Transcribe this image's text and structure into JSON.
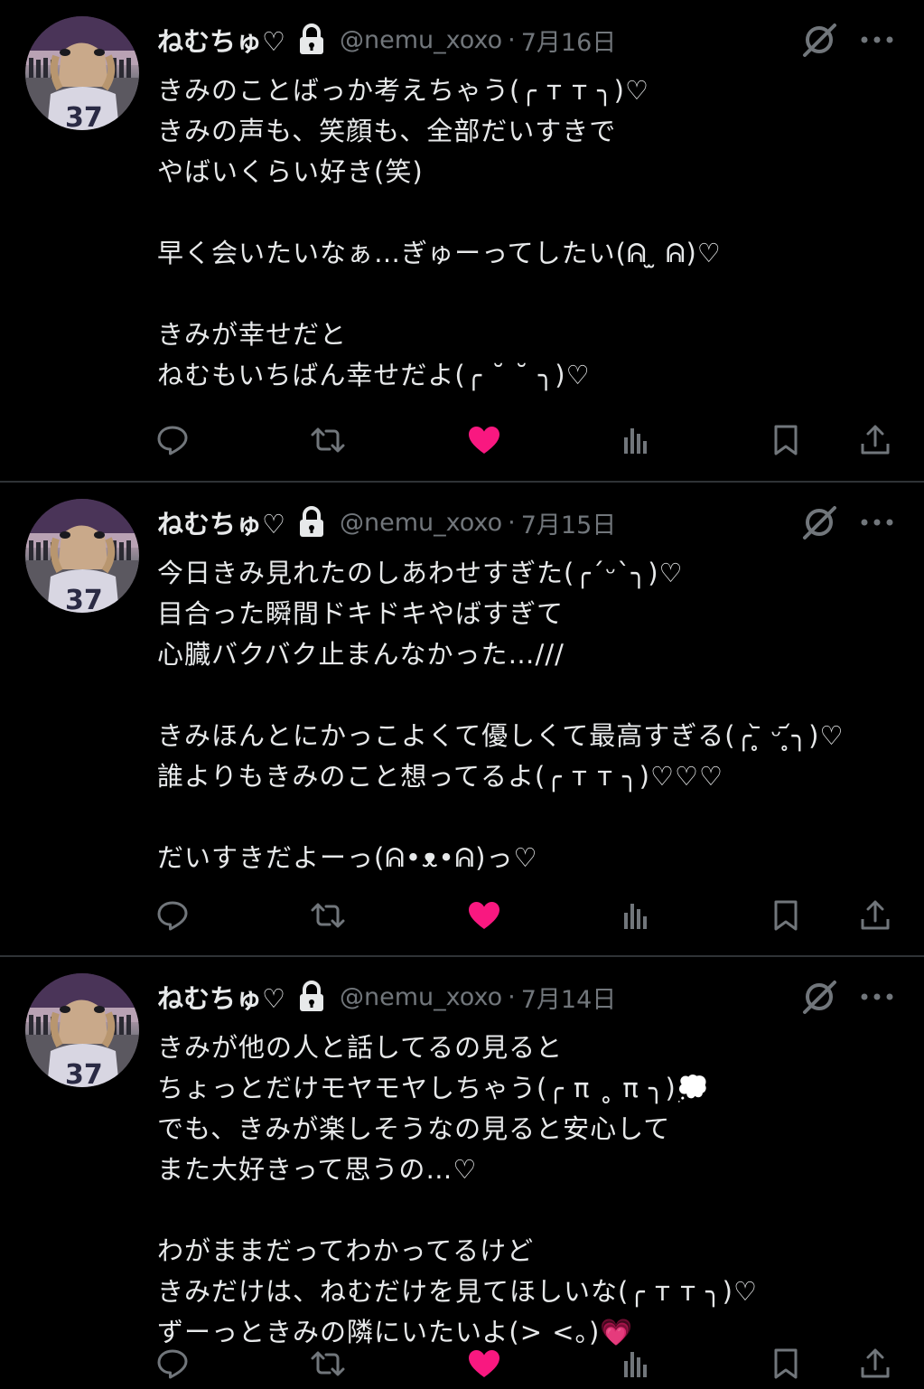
{
  "colors": {
    "background": "#000000",
    "text": "#e7e9ea",
    "muted": "#71767b",
    "like": "#f91880",
    "divider": "#2f3336"
  },
  "tweets": [
    {
      "display_name": "ねむちゅ♡",
      "handle": "@nemu_xoxo",
      "separator": "·",
      "date": "7月16日",
      "lines": [
        "きみのことばっか考えちゃう(╭ ᴛ ᴛ ╮)♡",
        "きみの声も、笑顔も、全部だいすきで",
        "やばいくらい好き(笑)",
        "",
        "早く会いたいなぁ…ぎゅーってしたい(ᕱ ̫ ᕱ)♡",
        "",
        "きみが幸せだと",
        "ねむもいちばん幸せだよ(╭ ˘ ˘ ╮)♡"
      ],
      "liked": true
    },
    {
      "display_name": "ねむちゅ♡",
      "handle": "@nemu_xoxo",
      "separator": "·",
      "date": "7月15日",
      "lines": [
        "今日きみ見れたのしあわせすぎた(╭ˊᵕˋ╮)♡",
        "目合った瞬間ドキドキやばすぎて",
        "心臓バクバク止まんなかった…///",
        "",
        "きみほんとにかっこよくて優しくて最高すぎる(╭ ̥᷅ ᵕ ̥᷄╮)♡",
        "誰よりもきみのこと想ってるよ(╭ ᴛ ᴛ ╮)♡♡♡",
        "",
        "だいすきだよーっ(ᕱ•ᴥ•ᕱ)っ♡"
      ],
      "liked": true
    },
    {
      "display_name": "ねむちゅ♡",
      "handle": "@nemu_xoxo",
      "separator": "·",
      "date": "7月14日",
      "lines": [
        "きみが他の人と話してるの見ると",
        "ちょっとだけモヤモヤしちゃう(╭ π ˳ π ╮)💭",
        "でも、きみが楽しそうなの見ると安心して",
        "また大好きって思うの…♡",
        "",
        "わがままだってわかってるけど",
        "きみだけは、ねむだけを見てほしいな(╭ ᴛ ᴛ ╮)♡",
        "ずーっときみの隣にいたいよ(> <。)💗"
      ],
      "liked": true
    }
  ]
}
